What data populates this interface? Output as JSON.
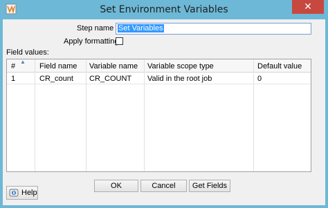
{
  "window": {
    "title": "Set Environment Variables"
  },
  "form": {
    "step_name_label": "Step name :",
    "step_name_value": "Set Variables",
    "apply_formatting_label": "Apply formatting",
    "apply_formatting_checked": false,
    "field_values_label": "Field values:"
  },
  "table": {
    "columns": [
      "#",
      "Field name",
      "Variable name",
      "Variable scope type",
      "Default value"
    ],
    "rows": [
      {
        "num": "1",
        "field_name": "CR_count",
        "variable_name": "CR_COUNT",
        "scope": "Valid in the root job",
        "default": "0"
      }
    ]
  },
  "buttons": {
    "ok": "OK",
    "cancel": "Cancel",
    "get_fields": "Get Fields",
    "help": "Help"
  },
  "colors": {
    "titlebar": "#6cb8d6",
    "close": "#c7483e",
    "selection": "#3399ff"
  }
}
